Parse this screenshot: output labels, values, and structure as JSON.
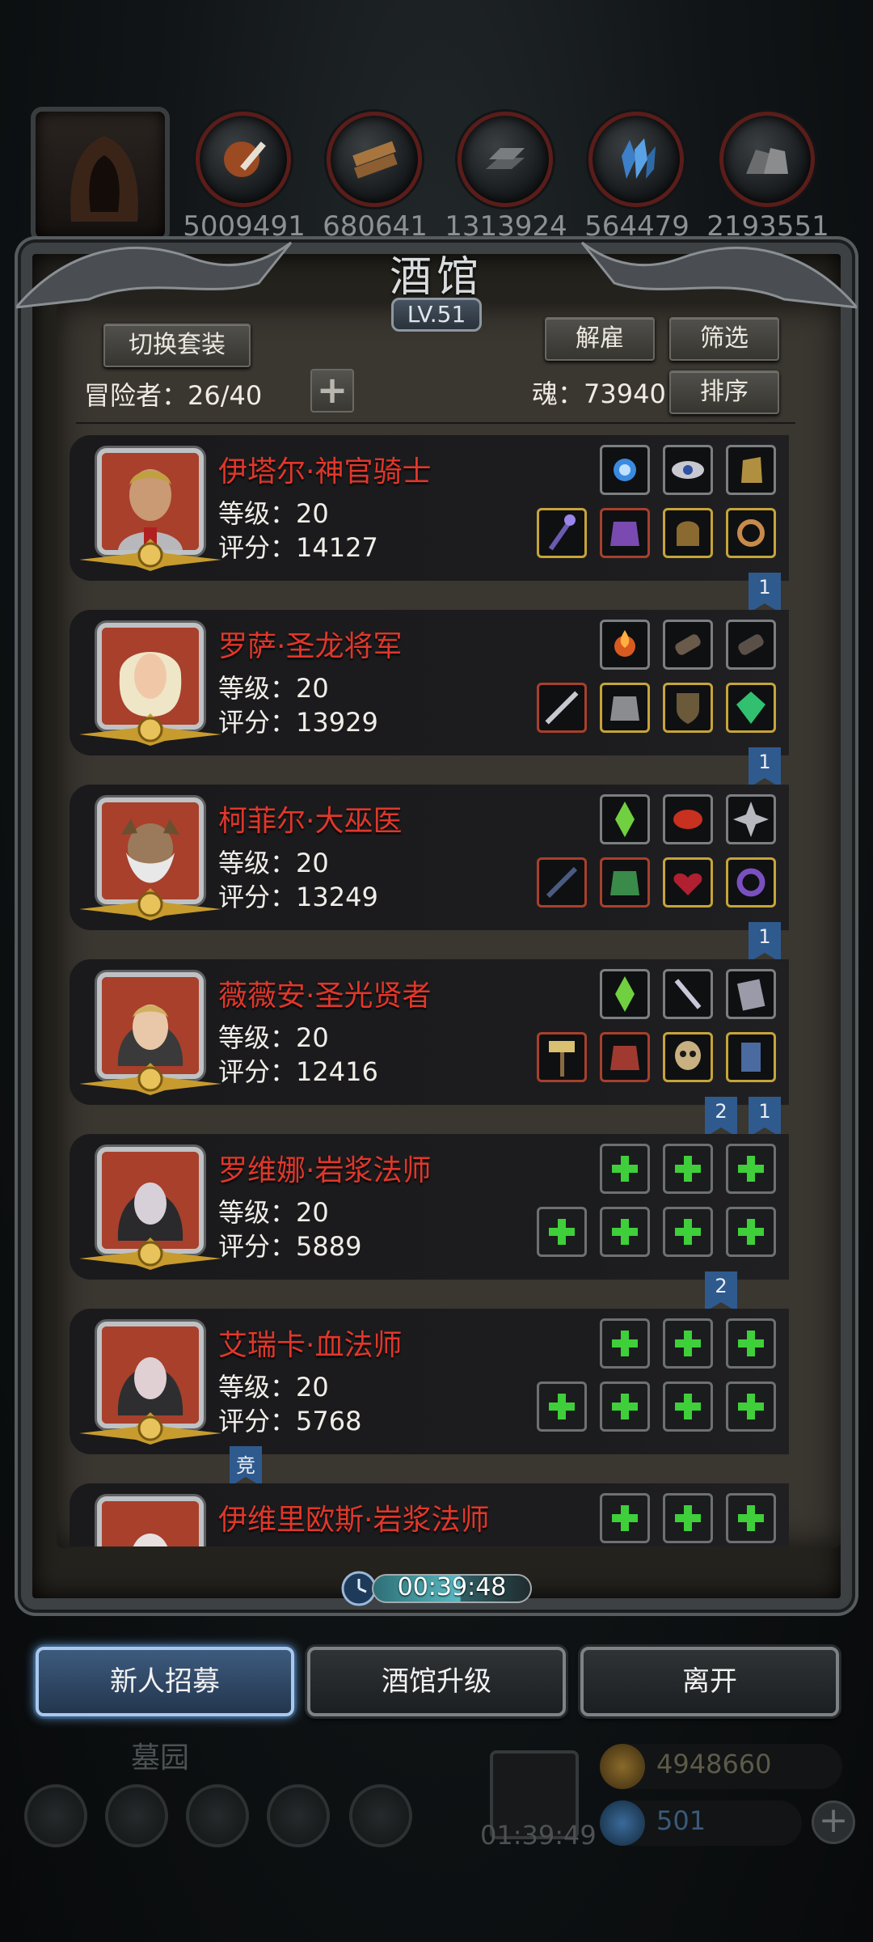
{
  "resources": {
    "values": [
      "5009491",
      "680641",
      "1313924",
      "564479",
      "2193551"
    ],
    "icons": [
      "hero-hood-icon",
      "meat-icon",
      "wood-icon",
      "iron-icon",
      "crystal-icon",
      "stone-icon"
    ]
  },
  "panel": {
    "title": "酒馆",
    "level": "LV.51",
    "switch_outfit": "切换套装",
    "dismiss": "解雇",
    "filter": "筛选",
    "sort": "排序",
    "adventurers_label": "冒险者：26/40",
    "soul_label": "魂：73940"
  },
  "adventurers": [
    {
      "name": "伊塔尔·神官骑士",
      "level": "等级：20",
      "score": "评分：14127"
    },
    {
      "name": "罗萨·圣龙将军",
      "level": "等级：20",
      "score": "评分：13929"
    },
    {
      "name": "柯菲尔·大巫医",
      "level": "等级：20",
      "score": "评分：13249"
    },
    {
      "name": "薇薇安·圣光贤者",
      "level": "等级：20",
      "score": "评分：12416"
    },
    {
      "name": "罗维娜·岩浆法师",
      "level": "等级：20",
      "score": "评分：5889"
    },
    {
      "name": "艾瑞卡·血法师",
      "level": "等级：20",
      "score": "评分：5768"
    },
    {
      "name": "伊维里欧斯·岩浆法师",
      "level": "",
      "score": ""
    }
  ],
  "ribbons": {
    "r1": "1",
    "r2": "1",
    "r3": "1",
    "r4a": "2",
    "r4b": "1",
    "r5": "2",
    "arena": "竞"
  },
  "timer": "00:39:48",
  "buttons": {
    "recruit": "新人招募",
    "upgrade": "酒馆升级",
    "leave": "离开"
  },
  "hud": {
    "location": "墓园",
    "gift_timer": "01:39:49",
    "gold": "4948660",
    "gems": "501"
  }
}
